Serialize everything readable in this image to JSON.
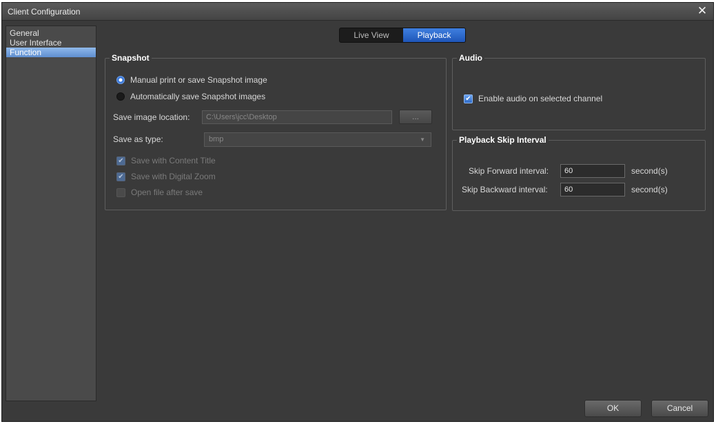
{
  "window": {
    "title": "Client Configuration"
  },
  "sidebar": {
    "items": [
      {
        "label": "General"
      },
      {
        "label": "User Interface"
      },
      {
        "label": "Function"
      }
    ]
  },
  "tabs": [
    {
      "label": "Live View"
    },
    {
      "label": "Playback"
    }
  ],
  "snapshot": {
    "title": "Snapshot",
    "manual_label": "Manual print or save Snapshot image",
    "auto_label": "Automatically save Snapshot images",
    "location_label": "Save image location:",
    "location_value": "C:\\Users\\jcc\\Desktop",
    "browse_label": "...",
    "type_label": "Save as type:",
    "type_value": "bmp",
    "content_title_label": "Save with Content Title",
    "digital_zoom_label": "Save with Digital Zoom",
    "open_after_label": "Open file after save"
  },
  "audio": {
    "title": "Audio",
    "enable_label": "Enable audio on selected channel"
  },
  "skip": {
    "title": "Playback Skip Interval",
    "forward_label": "Skip Forward interval:",
    "forward_value": "60",
    "backward_label": "Skip Backward interval:",
    "backward_value": "60",
    "unit": "second(s)"
  },
  "buttons": {
    "ok": "OK",
    "cancel": "Cancel"
  }
}
